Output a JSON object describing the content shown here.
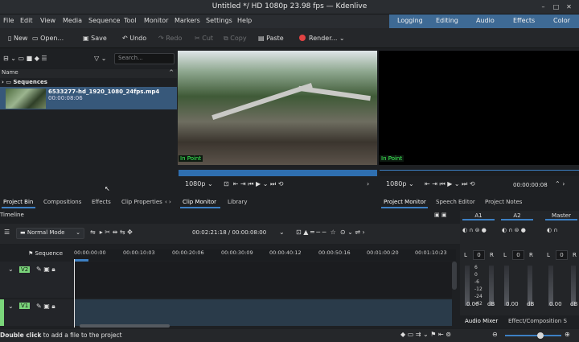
{
  "window": {
    "title": "Untitled */ HD 1080p 23.98 fps — Kdenlive"
  },
  "menu": [
    "File",
    "Edit",
    "View",
    "Media",
    "Sequence",
    "Tool",
    "Monitor",
    "Markers",
    "Settings",
    "Help"
  ],
  "workspaces": [
    "Logging",
    "Editing",
    "Audio",
    "Effects",
    "Color"
  ],
  "toolbar": {
    "new": "New",
    "open": "Open...",
    "save": "Save",
    "undo": "Undo",
    "redo": "Redo",
    "cut": "Cut",
    "copy": "Copy",
    "paste": "Paste",
    "render": "Render..."
  },
  "bin": {
    "search_placeholder": "Search...",
    "column_name": "Name",
    "folder": "Sequences",
    "clip": {
      "name": "6533277-hd_1920_1080_24fps.mp4",
      "duration": "00:00:08:06"
    },
    "tabs": [
      "Project Bin",
      "Compositions",
      "Effects",
      "Clip Properties"
    ]
  },
  "clip_monitor": {
    "in_point": "In Point",
    "resolution": "1080p",
    "tabs": [
      "Clip Monitor",
      "Library"
    ]
  },
  "project_monitor": {
    "in_point": "In Point",
    "resolution": "1080p",
    "timecode": "00:00:00:08",
    "tabs": [
      "Project Monitor",
      "Speech Editor",
      "Project Notes"
    ]
  },
  "timeline": {
    "title": "Timeline",
    "mode": "Normal Mode",
    "timecode": "00:02:21:18 / 00:00:08:00",
    "sequence_label": "Sequence",
    "ruler": [
      "00:00:00:00",
      "00:00:10:03",
      "00:00:20:06",
      "00:00:30:09",
      "00:00:40:12",
      "00:00:50:16",
      "00:01:00:20",
      "00:01:10:23"
    ],
    "tracks": [
      "V2",
      "V1"
    ]
  },
  "mixer": {
    "channels": [
      {
        "name": "A1",
        "value": "0.00",
        "unit": "dB",
        "pan": "0"
      },
      {
        "name": "A2",
        "value": "0.00",
        "unit": "dB",
        "pan": "0"
      },
      {
        "name": "Master",
        "value": "0.00",
        "unit": "dB",
        "pan": "0"
      }
    ],
    "scale": [
      "6",
      "0",
      "-6",
      "-12",
      "-24",
      "-42"
    ],
    "tabs": [
      "Audio Mixer",
      "Effect/Composition S"
    ]
  },
  "status": {
    "bold": "Double click",
    "rest": " to add a file to the project"
  }
}
